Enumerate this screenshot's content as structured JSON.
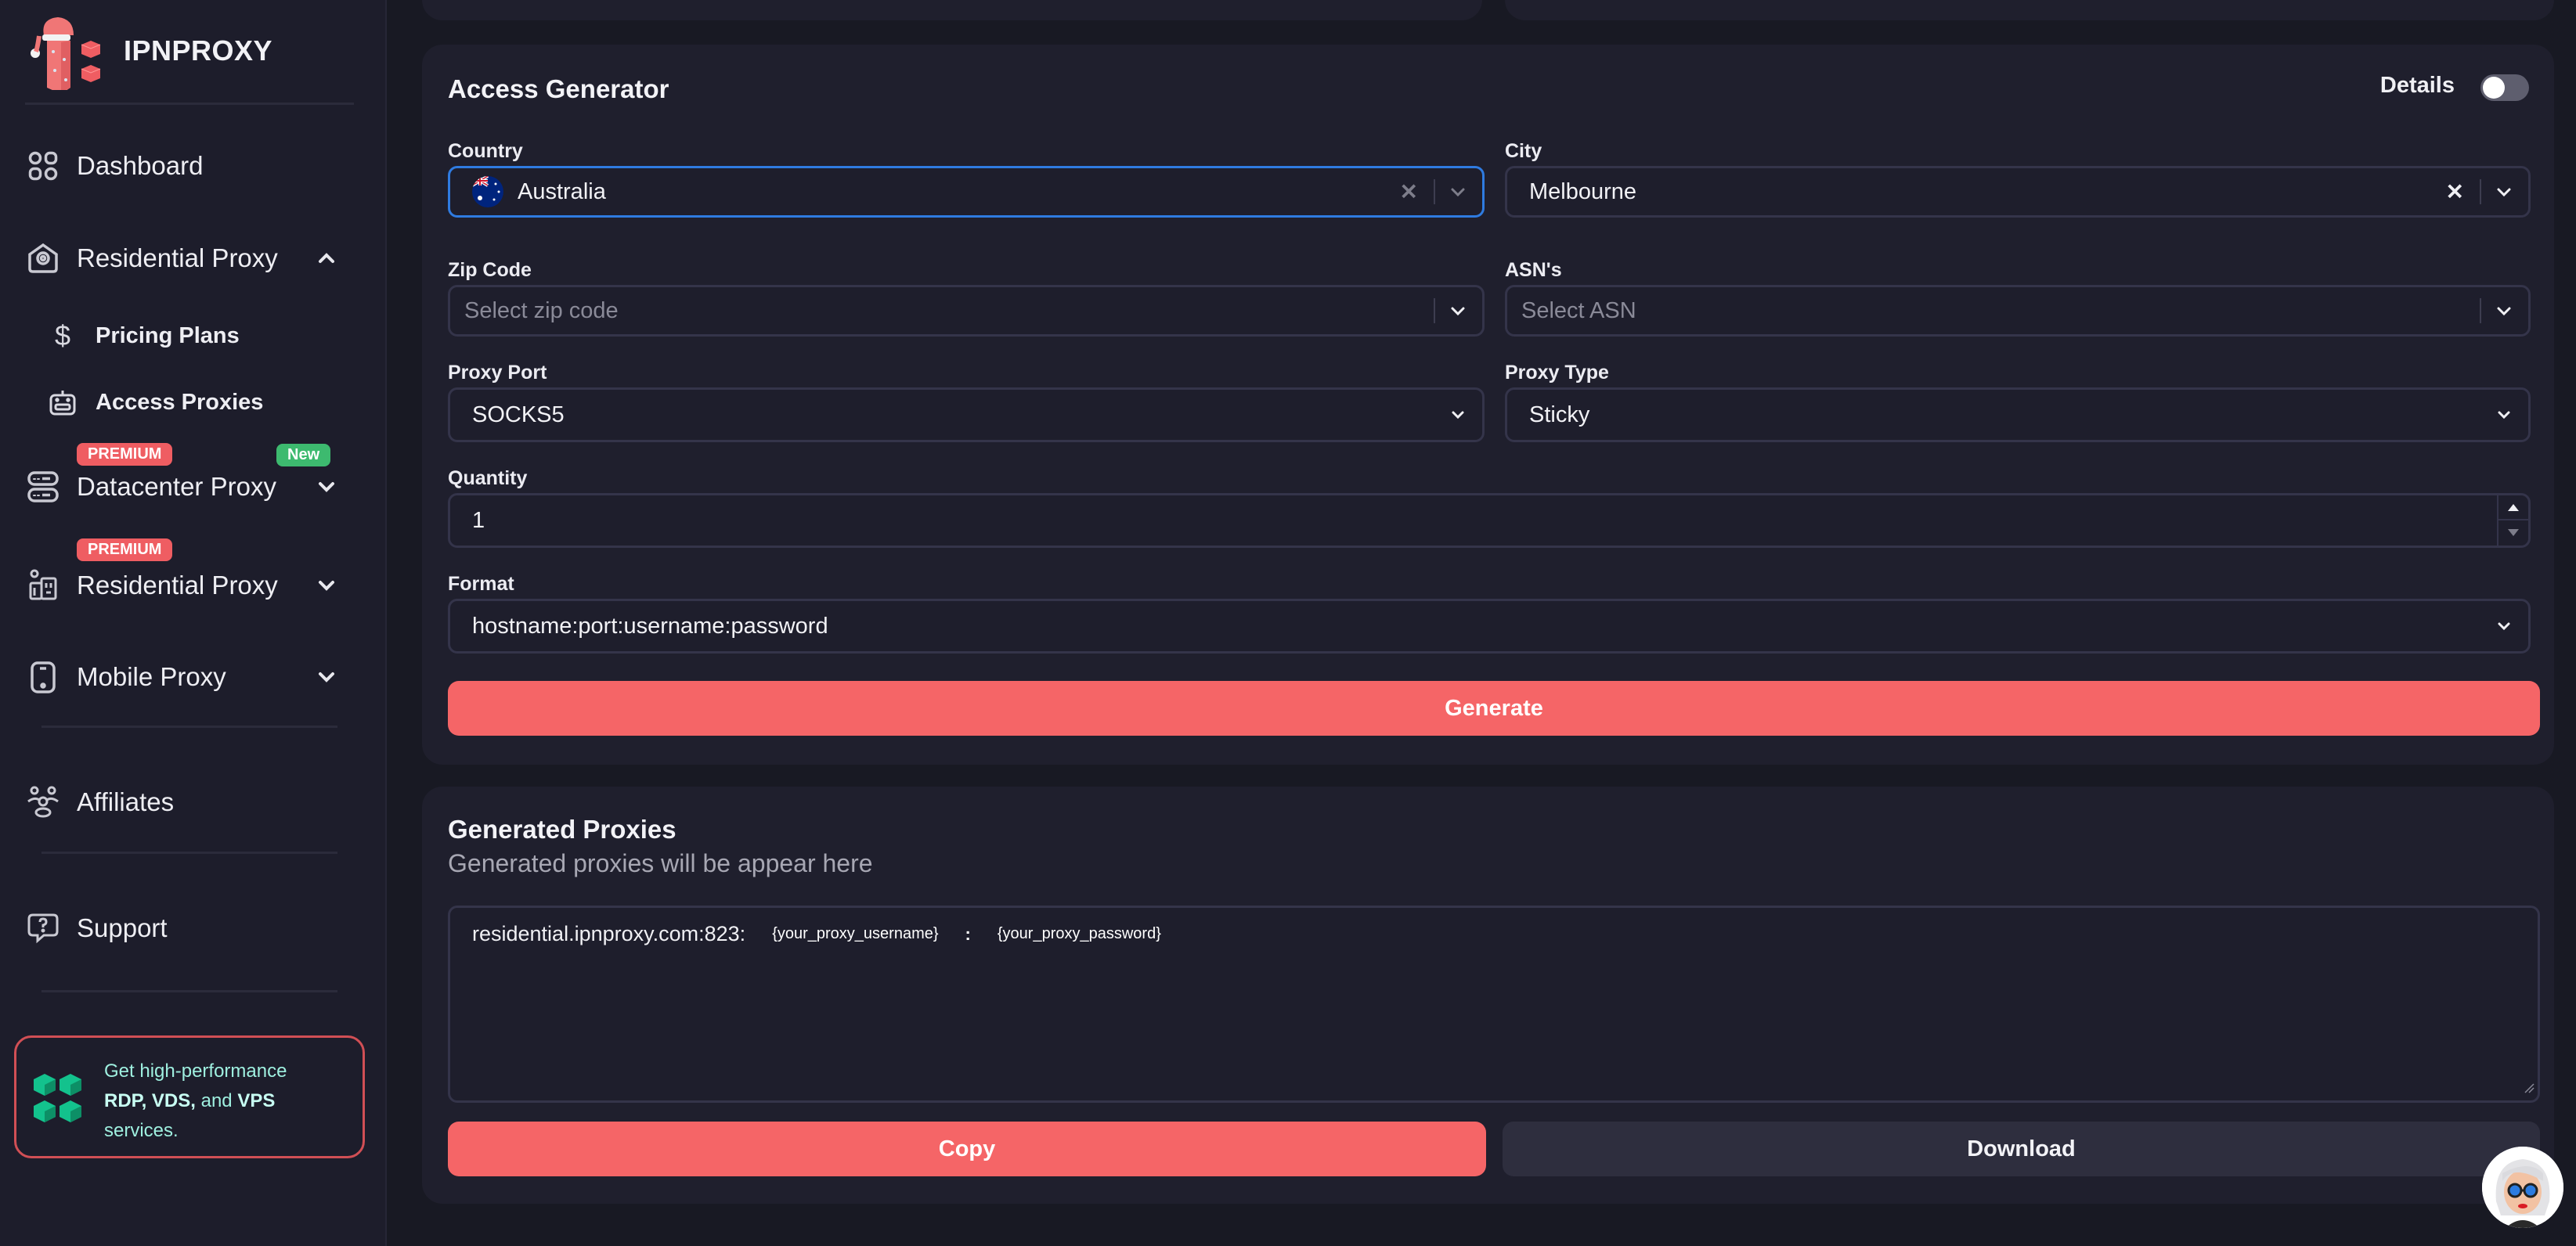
{
  "brand": {
    "name": "IPNPROXY"
  },
  "sidebar": {
    "items": [
      {
        "label": "Dashboard",
        "icon": "dashboard-grid-icon"
      },
      {
        "label": "Residential Proxy",
        "icon": "residential-home-icon",
        "expanded": true,
        "children": [
          {
            "label": "Pricing Plans",
            "icon": "dollar-icon"
          },
          {
            "label": "Access Proxies",
            "icon": "access-device-icon"
          }
        ]
      },
      {
        "label": "Datacenter Proxy",
        "icon": "server-icon",
        "badge": "PREMIUM",
        "badge_extra": "New"
      },
      {
        "label": "Residential Proxy",
        "icon": "building-icon",
        "badge": "PREMIUM"
      },
      {
        "label": "Mobile Proxy",
        "icon": "mobile-icon"
      },
      {
        "label": "Affiliates",
        "icon": "affiliates-people-icon"
      },
      {
        "label": "Support",
        "icon": "support-question-icon"
      }
    ],
    "promo": {
      "line1": "Get high-performance",
      "rdp": "RDP,",
      "vds": "VDS,",
      "and": "and",
      "vps": "VPS",
      "line3": "services."
    }
  },
  "generator": {
    "title": "Access Generator",
    "details_label": "Details",
    "details_on": false,
    "country": {
      "label": "Country",
      "value": "Australia",
      "flag": "australia-flag"
    },
    "city": {
      "label": "City",
      "value": "Melbourne"
    },
    "zip": {
      "label": "Zip Code",
      "placeholder": "Select zip code"
    },
    "asn": {
      "label": "ASN's",
      "placeholder": "Select ASN"
    },
    "proxy_port": {
      "label": "Proxy Port",
      "value": "SOCKS5"
    },
    "proxy_type": {
      "label": "Proxy Type",
      "value": "Sticky"
    },
    "quantity": {
      "label": "Quantity",
      "value": "1"
    },
    "format": {
      "label": "Format",
      "value": "hostname:port:username:password"
    },
    "generate_label": "Generate"
  },
  "generated": {
    "title": "Generated Proxies",
    "subtitle": "Generated proxies will be appear here",
    "host": "residential.ipnproxy.com:823:",
    "username": "{your_proxy_username}",
    "colon": ":",
    "password": "{your_proxy_password}",
    "copy_label": "Copy",
    "download_label": "Download"
  },
  "colors": {
    "accent": "#f56567",
    "premium": "#ef5d62",
    "new": "#3dba6f",
    "focus": "#2f7be0",
    "background": "#181923",
    "card": "#1f1f2d"
  }
}
